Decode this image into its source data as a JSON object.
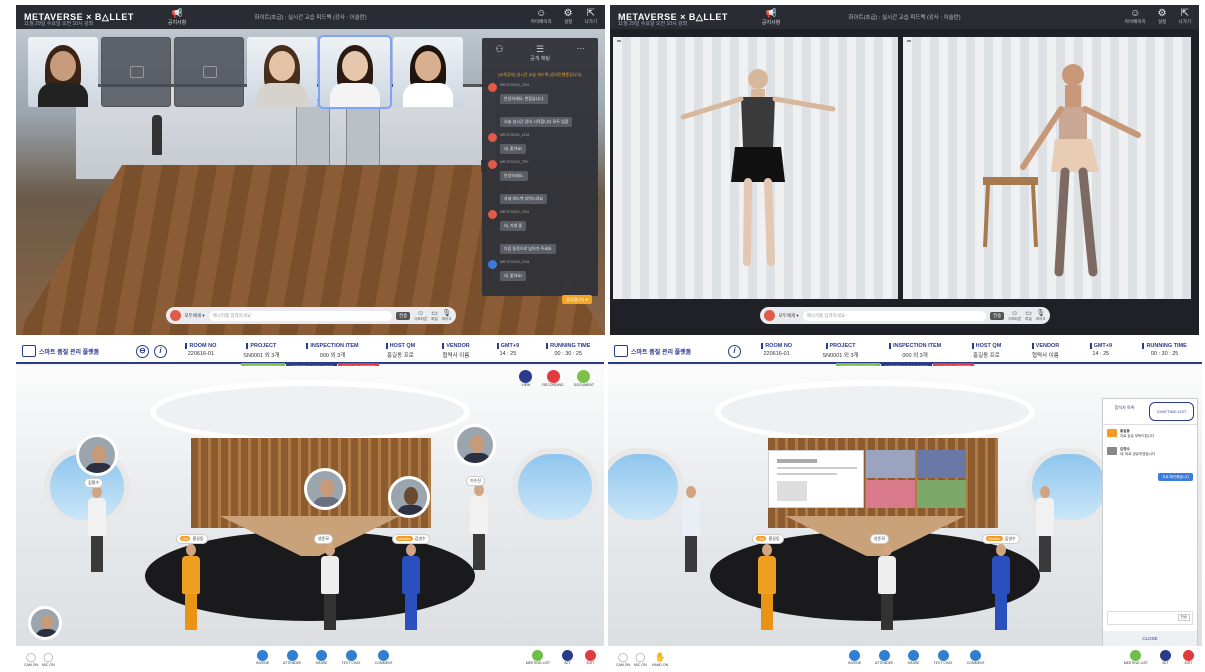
{
  "q1": {
    "brand": "METAVERSE × B△LLET",
    "brand_sub": "11월 29일 수요일 오전 10시 강좌",
    "notice_label": "공지사항",
    "cam_title": "화이트(초급) : 실시간 교습 피드백 (강사 : 이슬란)",
    "top_icons": [
      {
        "name": "face-icon",
        "label": "마이페이지"
      },
      {
        "name": "gear-icon",
        "label": "설정"
      },
      {
        "name": "exit-icon",
        "label": "나가기"
      }
    ],
    "thumbnails": [
      "",
      "",
      "",
      "",
      "",
      ""
    ],
    "chat": {
      "tab1": "",
      "tab2": "공개 채팅",
      "notice": "[교육공지] 실시간 교습 피드백 (강의진행중입니다)",
      "messages": [
        {
          "name": "MR.STUDIO_CSH",
          "text": "안녕하세요, 반갑습니다."
        },
        {
          "name": "",
          "text": "오늘 실시간 강의 시작합니다 모두 입장"
        },
        {
          "name": "MR.STUDIO_1234",
          "text": "네, 좋아요!"
        },
        {
          "name": "MR.STUDIO_TRY",
          "text": "안녕하세요."
        },
        {
          "name": "",
          "text": "자세 피드백 부탁드려요"
        },
        {
          "name": "MR.STUDIO_CSH",
          "text": "네, 기대 중"
        },
        {
          "name": "",
          "text": "다음 동작으로 넘어가 주세요"
        },
        {
          "name": "MR.STUDIO_1234",
          "text": "네, 좋아요!"
        }
      ],
      "mine": "감사합니다 ♥"
    },
    "input": {
      "select": "모두에게",
      "placeholder": "메시지를 입력하세요",
      "send": "전송",
      "icons": [
        "이모티콘",
        "파일",
        "마이크"
      ]
    }
  },
  "q2": {
    "brand": "METAVERSE × B△LLET",
    "brand_sub": "11월 29일 수요일 오전 10시 강좌",
    "notice_label": "공지사항",
    "cam_title": "화이트(초급) : 실시간 교습 피드백 (강사 : 이슬란)",
    "top_icons": [
      {
        "name": "face-icon",
        "label": "마이페이지"
      },
      {
        "name": "gear-icon",
        "label": "설정"
      },
      {
        "name": "exit-icon",
        "label": "나가기"
      }
    ],
    "input": {
      "select": "모두에게",
      "placeholder": "메시지를 입력하세요",
      "send": "전송",
      "icons": [
        "이모티콘",
        "파일",
        "마이크"
      ]
    }
  },
  "meeting": {
    "logo_text": "스마트 품질 관리 플랫폼",
    "columns": [
      {
        "h": "ROOM NO",
        "v": "220616-01"
      },
      {
        "h": "PROJECT",
        "v": "SN0001 외 3개"
      },
      {
        "h": "INSPECTION ITEM",
        "v": "000 외 3개"
      },
      {
        "h": "HOST QM",
        "v": "홍길동 프로"
      },
      {
        "h": "VENDOR",
        "v": "협력사 이름"
      },
      {
        "h": "GMT+9",
        "v": "14 : 25"
      },
      {
        "h": "RUNNING TIME",
        "v": "00 : 30 : 25"
      }
    ],
    "pills": [
      {
        "label": "INSPECTION RESULT",
        "color": "#7cc04b"
      },
      {
        "label": "INSPECTION DOCUMENT",
        "color": "#2a3a8c"
      },
      {
        "label": "SUMMARY REPORT",
        "color": "#e23b3b"
      }
    ],
    "tr_buttons": [
      {
        "label": "VIEW",
        "color": "#2a3a8c"
      },
      {
        "label": "RECORDING",
        "color": "#e23b3b"
      },
      {
        "label": "DOCUMENT",
        "color": "#7cc04b"
      }
    ],
    "avatar_tags": [
      "홍길동",
      "양준모",
      "김영수",
      "김철수",
      "이수진",
      "박지훈"
    ],
    "bottom_left": [
      "CAM ON",
      "MIC ON"
    ],
    "bottom_center": [
      "INVENE",
      "ATTENDEE",
      "SHARE",
      "TEXT CHAT",
      "COMMENT"
    ],
    "bottom_right": [
      "MEETING LIST",
      "SET",
      "EXIT"
    ]
  },
  "meeting2": {
    "logo_text": "스마트 품질 관리 플랫폼",
    "columns": [
      {
        "h": "ROOM NO",
        "v": "220616-01"
      },
      {
        "h": "PROJECT",
        "v": "SN0001 외 3개"
      },
      {
        "h": "INSPECTION ITEM",
        "v": "000 외 3개"
      },
      {
        "h": "HOST QM",
        "v": "홍길동 프로"
      },
      {
        "h": "VENDOR",
        "v": "협력사 이름"
      },
      {
        "h": "GMT+9",
        "v": "14 : 25"
      },
      {
        "h": "RUNNING TIME",
        "v": "00 : 30 : 25"
      }
    ],
    "pills": [
      {
        "label": "INSPECTION RESULT",
        "color": "#7cc04b"
      },
      {
        "label": "INSPECTION DOCUMENT",
        "color": "#2a3a8c"
      },
      {
        "label": "SUMMARY REPORT",
        "color": "#e23b3b"
      }
    ],
    "panel": {
      "tab1": "참석자 목록",
      "tab2": "CHATTING LIST",
      "msgs": [
        {
          "n": "홍길동",
          "t": "자료 공유 부탁드립니다"
        },
        {
          "n": "김영수",
          "t": "네, 바로 공유하겠습니다"
        }
      ],
      "mine": "자료 확인했습니다",
      "send": "전송",
      "close": "CLOSE"
    },
    "bottom_left": [
      "CAM ON",
      "MIC ON",
      "HAND ON"
    ],
    "bottom_center": [
      "INVENE",
      "ATTENDEE",
      "SHARE",
      "TEXT CHAT",
      "COMMENT"
    ],
    "bottom_right": [
      "MEETING LIST",
      "SET",
      "EXIT"
    ]
  }
}
